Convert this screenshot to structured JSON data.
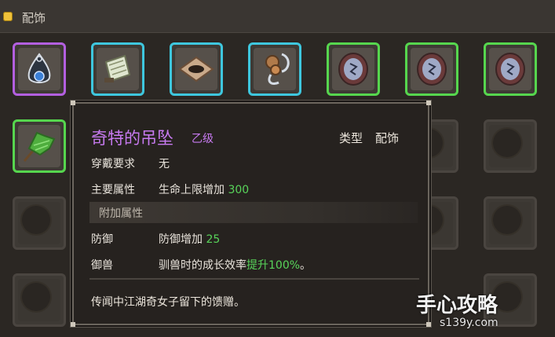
{
  "header": {
    "title": "配饰"
  },
  "tooltip": {
    "name": "奇特的吊坠",
    "grade": "乙级",
    "type_label": "类型",
    "type_value": "配饰",
    "requirement_label": "穿戴要求",
    "requirement_value": "无",
    "main_attr_label": "主要属性",
    "main_attr_text": "生命上限增加",
    "main_attr_value": "300",
    "extra_header": "附加属性",
    "extra": [
      {
        "label": "防御",
        "text": "防御增加",
        "value": "25",
        "suffix": ""
      },
      {
        "label": "御兽",
        "text": "驯兽时的成长效率",
        "value": "提升100%",
        "suffix": "。"
      }
    ],
    "flavor": "传闻中江湖奇女子留下的馈赠。"
  },
  "watermark": {
    "brand": "手心攻略",
    "url": "s139y.com"
  },
  "colors": {
    "purple_rarity": "#b35fe0",
    "cyan_rarity": "#3ec7de",
    "green_rarity": "#56d64e",
    "highlight": "#58d45a",
    "title": "#c77af0"
  },
  "items": [
    {
      "icon": "pendant-icon",
      "rarity": "purple"
    },
    {
      "icon": "scroll-icon",
      "rarity": "cyan"
    },
    {
      "icon": "eye-talisman-icon",
      "rarity": "cyan"
    },
    {
      "icon": "hook-gourd-icon",
      "rarity": "cyan"
    },
    {
      "icon": "medallion-icon",
      "rarity": "green"
    },
    {
      "icon": "medallion-icon",
      "rarity": "green"
    },
    {
      "icon": "medallion-icon",
      "rarity": "green"
    },
    {
      "icon": "herb-icon",
      "rarity": "green"
    }
  ]
}
